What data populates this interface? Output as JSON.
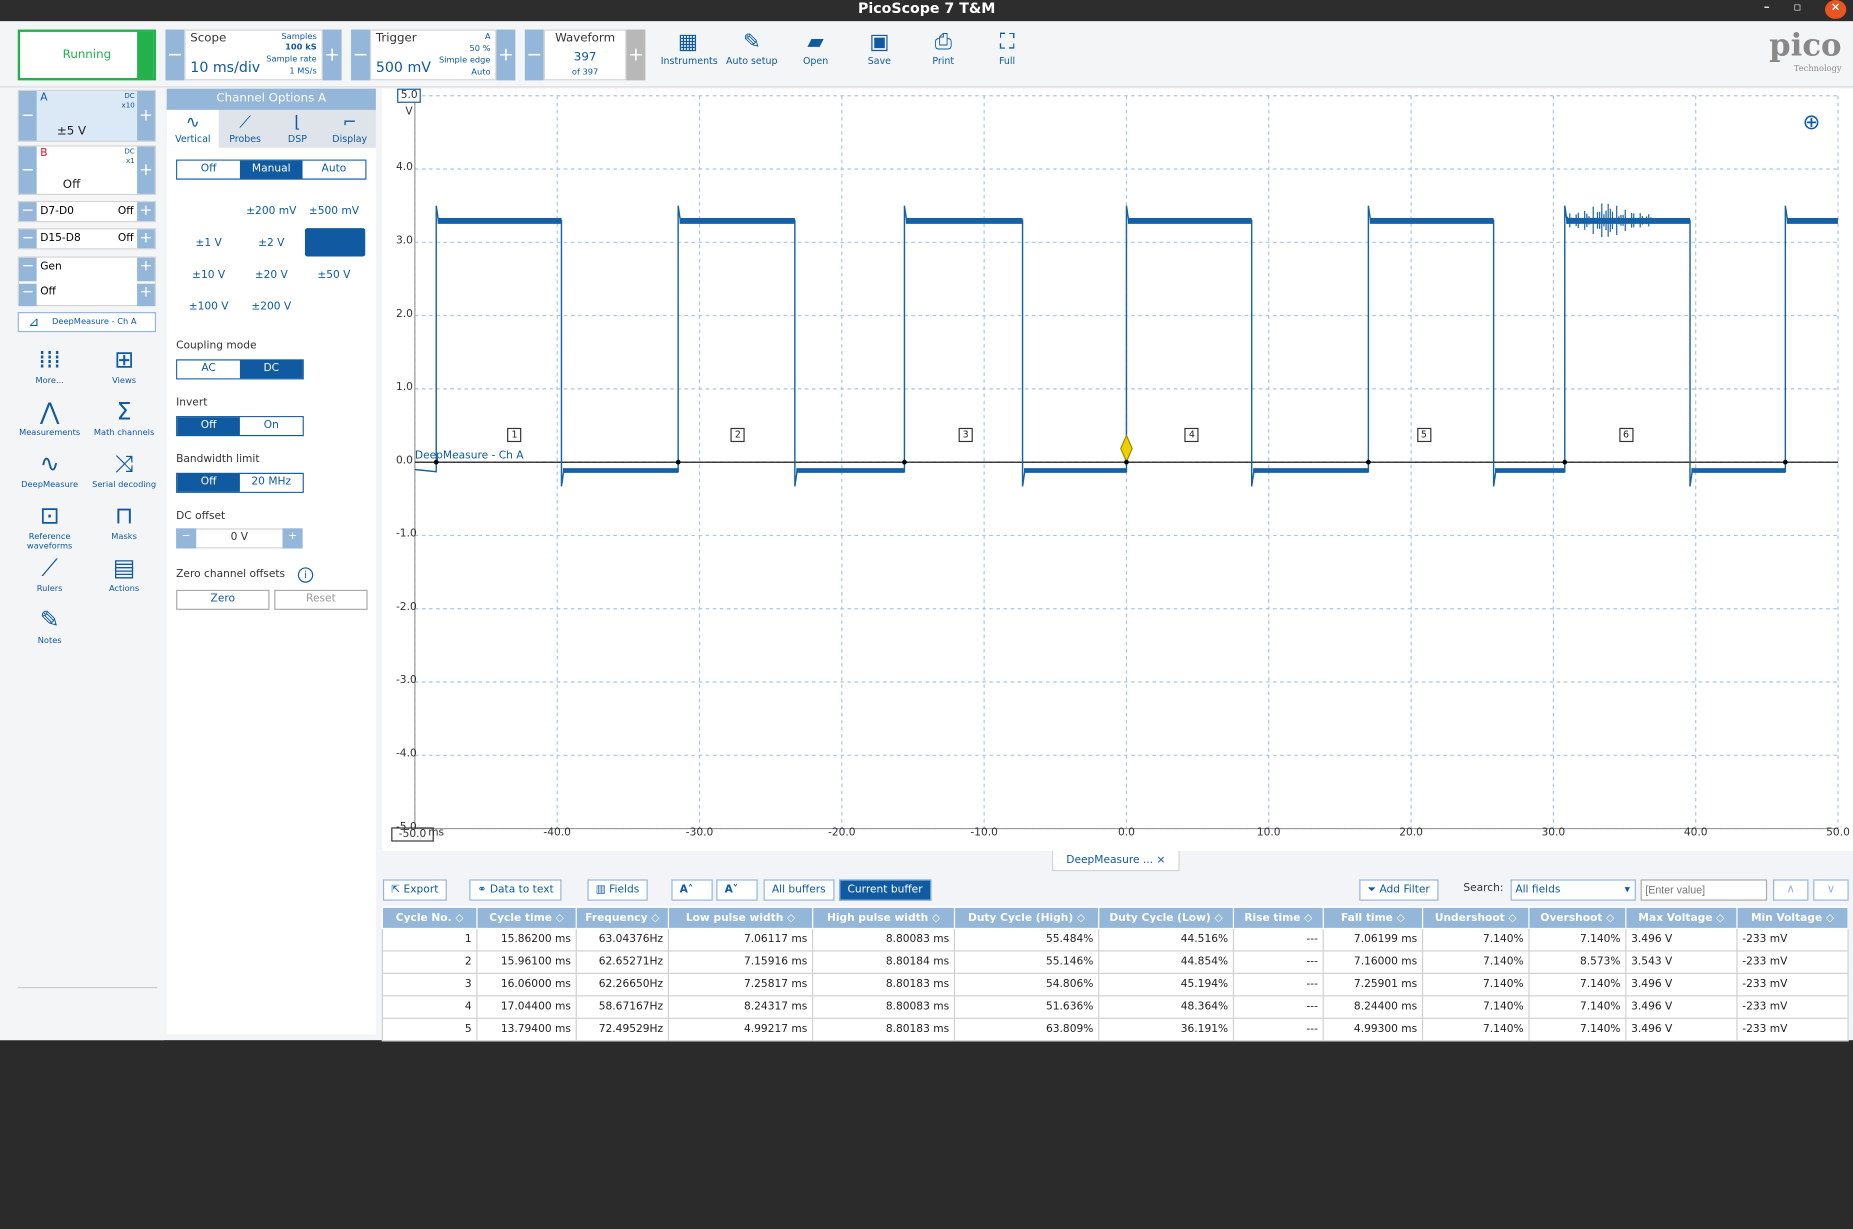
{
  "window": {
    "title": "PicoScope 7 T&M",
    "min": "–",
    "max": "▫",
    "close": "×"
  },
  "toolbar": {
    "run_label": "Running",
    "scope": {
      "label": "Scope",
      "timebase": "10 ms/div",
      "samples_label": "Samples",
      "samples": "100 kS",
      "rate_label": "Sample rate",
      "rate": "1 MS/s"
    },
    "trigger": {
      "label": "Trigger",
      "level": "500 mV",
      "ch": "A",
      "pct": "50 %",
      "type": "Simple edge",
      "mode": "Auto"
    },
    "waveform": {
      "label": "Waveform",
      "num": "397",
      "of": "of 397"
    },
    "instruments": "Instruments",
    "auto_setup": "Auto setup",
    "open": "Open",
    "save": "Save",
    "print": "Print",
    "full": "Full",
    "logo": "pico",
    "logo_sub": "Technology"
  },
  "sidebar": {
    "chA": {
      "letter": "A",
      "coupling": "DC",
      "probe": "x10",
      "range": "±5 V"
    },
    "chB": {
      "letter": "B",
      "coupling": "DC",
      "probe": "x1",
      "range": "Off"
    },
    "d7": {
      "label": "D7-D0",
      "state": "Off"
    },
    "d15": {
      "label": "D15-D8",
      "state": "Off"
    },
    "gen": {
      "label": "Gen",
      "state": "Off"
    },
    "deepmeasure": "DeepMeasure - Ch A",
    "tools": [
      "More...",
      "Views",
      "Measurements",
      "Math channels",
      "DeepMeasure",
      "Serial decoding",
      "Reference waveforms",
      "Masks",
      "Rulers",
      "Actions",
      "Notes"
    ]
  },
  "options": {
    "header": "Channel Options  A",
    "tabs": [
      "Vertical",
      "Probes",
      "DSP",
      "Display"
    ],
    "mode": [
      "Off",
      "Manual",
      "Auto"
    ],
    "ranges": [
      "±200 mV",
      "±500 mV",
      "±1 V",
      "±2 V",
      "±10 V",
      "±20 V",
      "±50 V",
      "±100 V",
      "±200 V"
    ],
    "coupling_title": "Coupling mode",
    "coupling": [
      "AC",
      "DC"
    ],
    "invert_title": "Invert",
    "invert": [
      "Off",
      "On"
    ],
    "bw_title": "Bandwidth limit",
    "bw": [
      "Off",
      "20 MHz"
    ],
    "offset_title": "DC offset",
    "offset": "0 V",
    "zero_title": "Zero channel offsets",
    "zero": "Zero",
    "reset": "Reset"
  },
  "scope": {
    "yunit": "V",
    "ytop": "5.0",
    "yticks": [
      "4.0",
      "3.0",
      "2.0",
      "1.0",
      "0.0",
      "-1.0",
      "-2.0",
      "-3.0",
      "-4.0",
      "-5.0"
    ],
    "xfirst": "-50.0",
    "xunit": "ms",
    "xticks": [
      "-40.0",
      "-30.0",
      "-20.0",
      "-10.0",
      "0.0",
      "10.0",
      "20.0",
      "30.0",
      "40.0",
      "50.0"
    ],
    "markers": [
      "1",
      "2",
      "3",
      "4",
      "5",
      "6"
    ],
    "trace_label": "DeepMeasure - Ch A",
    "trace_color": "#1461a8"
  },
  "bottom": {
    "tab": "DeepMeasure ...",
    "export": "Export",
    "data_to_text": "Data to text",
    "fields": "Fields",
    "all_buffers": "All buffers",
    "current_buffer": "Current buffer",
    "add_filter": "Add Filter",
    "search_label": "Search:",
    "search_field": "All fields",
    "search_placeholder": "[Enter value]"
  },
  "table": {
    "headers": [
      "Cycle No.",
      "Cycle time",
      "Frequency",
      "Low pulse width",
      "High pulse width",
      "Duty Cycle (High)",
      "Duty Cycle (Low)",
      "Rise time",
      "Fall time",
      "Undershoot",
      "Overshoot",
      "Max Voltage",
      "Min Voltage"
    ],
    "rows": [
      [
        "1",
        "15.86200 ms",
        "63.04376Hz",
        "7.06117 ms",
        "8.80083 ms",
        "55.484%",
        "44.516%",
        "---",
        "7.06199 ms",
        "7.140%",
        "7.140%",
        "3.496 V",
        "-233 mV"
      ],
      [
        "2",
        "15.96100 ms",
        "62.65271Hz",
        "7.15916 ms",
        "8.80184 ms",
        "55.146%",
        "44.854%",
        "---",
        "7.16000 ms",
        "7.140%",
        "8.573%",
        "3.543 V",
        "-233 mV"
      ],
      [
        "3",
        "16.06000 ms",
        "62.26650Hz",
        "7.25817 ms",
        "8.80183 ms",
        "54.806%",
        "45.194%",
        "---",
        "7.25901 ms",
        "7.140%",
        "7.140%",
        "3.496 V",
        "-233 mV"
      ],
      [
        "4",
        "17.04400 ms",
        "58.67167Hz",
        "8.24317 ms",
        "8.80083 ms",
        "51.636%",
        "48.364%",
        "---",
        "8.24400 ms",
        "7.140%",
        "7.140%",
        "3.496 V",
        "-233 mV"
      ],
      [
        "5",
        "13.79400 ms",
        "72.49529Hz",
        "4.99217 ms",
        "8.80183 ms",
        "63.809%",
        "36.191%",
        "---",
        "4.99300 ms",
        "7.140%",
        "7.140%",
        "3.496 V",
        "-233 mV"
      ]
    ]
  }
}
